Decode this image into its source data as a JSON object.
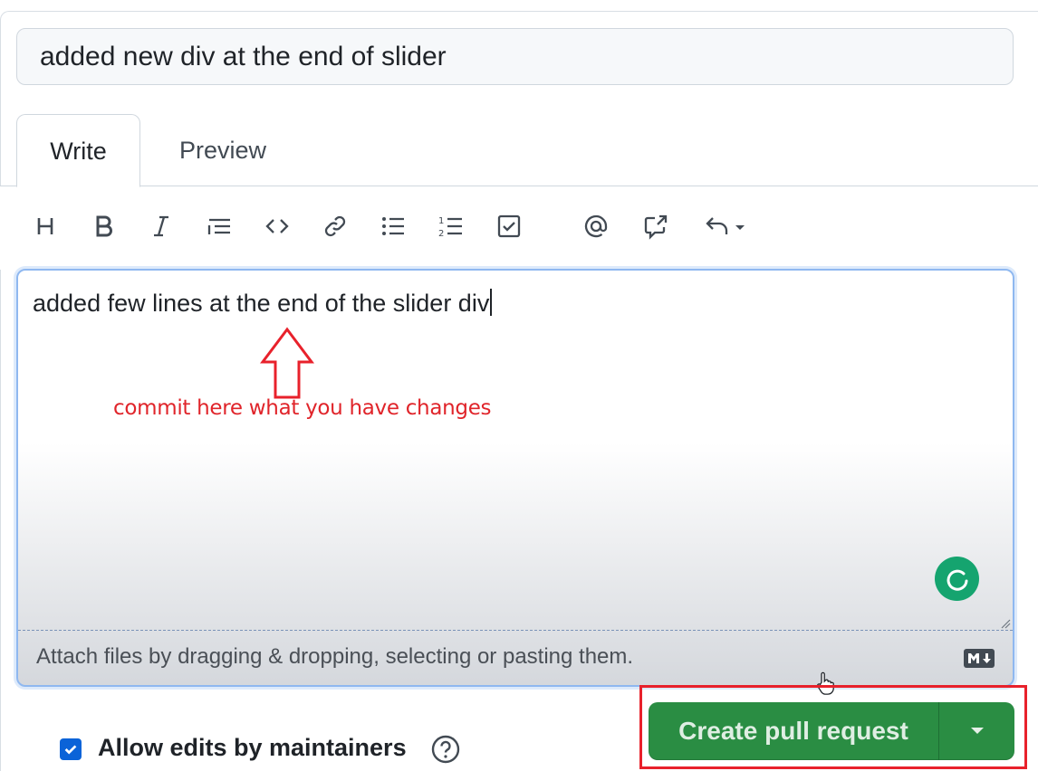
{
  "title_field": {
    "value": "added new div at the end of slider"
  },
  "tabs": [
    {
      "label": "Write"
    },
    {
      "label": "Preview"
    }
  ],
  "toolbar": {
    "icons": [
      "heading-icon",
      "bold-icon",
      "italic-icon",
      "quote-icon",
      "code-icon",
      "link-icon",
      "unordered-list-icon",
      "ordered-list-icon",
      "task-list-icon",
      "mention-icon",
      "reference-icon",
      "undo-icon"
    ]
  },
  "editor": {
    "value": "added few lines at the end of the slider div",
    "attach_hint": "Attach files by dragging & dropping, selecting or pasting them."
  },
  "annotation": {
    "text": "commit here what you have changes",
    "color": "#e0242a"
  },
  "actions": {
    "create_pr_label": "Create pull request",
    "button_color": "#2a8d43"
  },
  "options": {
    "allow_edits_label": "Allow edits by maintainers",
    "allow_edits_checked": true
  }
}
